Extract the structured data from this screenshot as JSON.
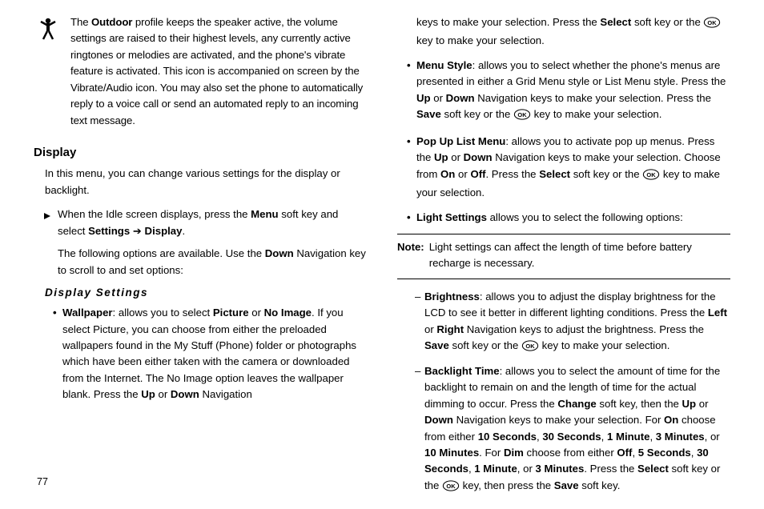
{
  "left": {
    "outdoor_text_pre": "The ",
    "outdoor_bold": "Outdoor",
    "outdoor_text_post": " profile keeps the speaker active, the volume settings are raised to their highest levels, any currently active ringtones or melodies are activated, and the phone's vibrate feature is activated. This icon is accompanied on screen by the Vibrate/Audio icon. You may also set the phone to automatically reply to a voice call or send an automated reply to an incoming text message.",
    "display_heading": "Display",
    "display_intro": "In this menu, you can change various settings for the display or backlight.",
    "step1_a": "When the Idle screen displays, press the ",
    "step1_b": "Menu",
    "step1_c": " soft key and select ",
    "step1_d": "Settings",
    "step1_arrow": " ➔ ",
    "step1_e": "Display",
    "step1_f": ".",
    "step2_a": "The following options are available. Use the ",
    "step2_b": "Down",
    "step2_c": " Navigation key to scroll to and set options:",
    "settings_heading": "Display   Settings",
    "wallpaper_label": "Wallpaper",
    "wallpaper_a": ": allows you to select ",
    "wallpaper_b": "Picture",
    "wallpaper_c": " or ",
    "wallpaper_d": "No Image",
    "wallpaper_e": ". If you select Picture, you can choose from either the preloaded wallpapers found in the My Stuff (Phone) folder or photographs which have been either taken with the camera or downloaded from the Internet. The No Image option leaves the wallpaper blank. Press the ",
    "wallpaper_f": "Up",
    "wallpaper_g": " or ",
    "wallpaper_h": "Down",
    "wallpaper_i": " Navigation"
  },
  "right": {
    "cont_a": "keys to make your selection. Press the ",
    "cont_b": "Select",
    "cont_c": " soft key or the ",
    "cont_d": " key to make your selection.",
    "menu_label": "Menu Style",
    "menu_a": ": allows you to select whether the phone's menus are presented in either a Grid Menu style or List Menu style. Press the ",
    "menu_b": "Up",
    "menu_c": " or ",
    "menu_d": "Down",
    "menu_e": " Navigation keys to make your selection. Press the ",
    "menu_f": "Save",
    "menu_g": " soft key or the ",
    "menu_h": " key to make your selection.",
    "popup_label": "Pop Up List Menu",
    "popup_a": ": allows you to activate pop up menus. Press the ",
    "popup_b": "Up",
    "popup_c": " or ",
    "popup_d": "Down",
    "popup_e": " Navigation keys to make your selection. Choose from ",
    "popup_f": "On",
    "popup_g": " or ",
    "popup_h": "Off",
    "popup_i": ". Press the ",
    "popup_j": "Select",
    "popup_k": " soft key or the ",
    "popup_l": " key to make your selection.",
    "light_label": "Light Settings",
    "light_a": " allows you to select the following options:",
    "note_label": "Note:",
    "note_text": "Light settings can affect the length of time before battery recharge is necessary.",
    "bright_label": "Brightness",
    "bright_a": ": allows you to adjust the display brightness for the LCD to see it better in different lighting conditions. Press the ",
    "bright_b": "Left",
    "bright_c": " or ",
    "bright_d": "Right",
    "bright_e": " Navigation keys to adjust the brightness. Press the ",
    "bright_f": "Save",
    "bright_g": " soft key or the ",
    "bright_h": " key to make your selection.",
    "back_label": "Backlight Time",
    "back_a": ": allows you to select the amount of time for the backlight to remain on and the length of time for the actual dimming to occur. Press the ",
    "back_b": "Change",
    "back_c": " soft key, then the ",
    "back_d": "Up",
    "back_e": " or ",
    "back_f": "Down",
    "back_g": " Navigation keys to make your selection. For ",
    "back_h": "On",
    "back_i": " choose from either ",
    "back_j": "10 Seconds",
    "back_k": ", ",
    "back_l": "30 Seconds",
    "back_m": ", ",
    "back_n": "1 Minute",
    "back_o": ", ",
    "back_p": "3 Minutes",
    "back_q": ", or ",
    "back_r": "10 Minutes",
    "back_s": ". For ",
    "back_t": "Dim",
    "back_u": " choose from either ",
    "back_v": "Off",
    "back_w": ", ",
    "back_x": "5 Seconds",
    "back_y": ", ",
    "back_z": "30 Seconds",
    "back_z1": ", ",
    "back_z2": "1 Minute",
    "back_z3": ", or ",
    "back_z4": "3 Minutes",
    "back_z5": ". Press the ",
    "back_z6": "Select",
    "back_z7": " soft key or the ",
    "back_z8": " key, then press the ",
    "back_z9": "Save",
    "back_z10": " soft key."
  },
  "page": "77"
}
